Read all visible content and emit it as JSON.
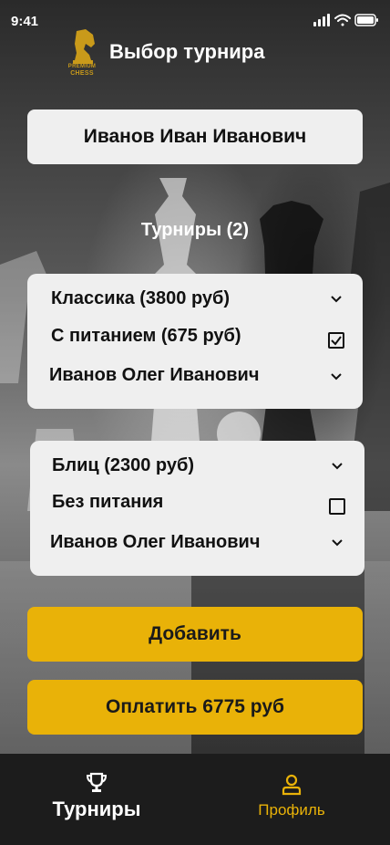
{
  "status_bar": {
    "time": "9:41"
  },
  "header": {
    "logo_text_1": "PREMIUM",
    "logo_text_2": "CHESS",
    "title": "Выбор турнира"
  },
  "player_name": "Иванов Иван Иванович",
  "section_title": "Турниры (2)",
  "tournaments": [
    {
      "type": "Классика (3800 руб)",
      "meal": "С питанием (675 руб)",
      "meal_checked": true,
      "player": "Иванов Олег Иванович"
    },
    {
      "type": "Блиц (2300 руб)",
      "meal": "Без питания",
      "meal_checked": false,
      "player": "Иванов Олег Иванович"
    }
  ],
  "buttons": {
    "add": "Добавить",
    "pay": "Оплатить 6775 руб"
  },
  "tabbar": {
    "tournaments": {
      "label": "Турниры",
      "icon": "trophy-icon"
    },
    "profile": {
      "label": "Профиль",
      "icon": "person-icon"
    }
  },
  "colors": {
    "accent": "#e9b208",
    "card": "#efefef",
    "tabbar": "#1c1c1c"
  }
}
